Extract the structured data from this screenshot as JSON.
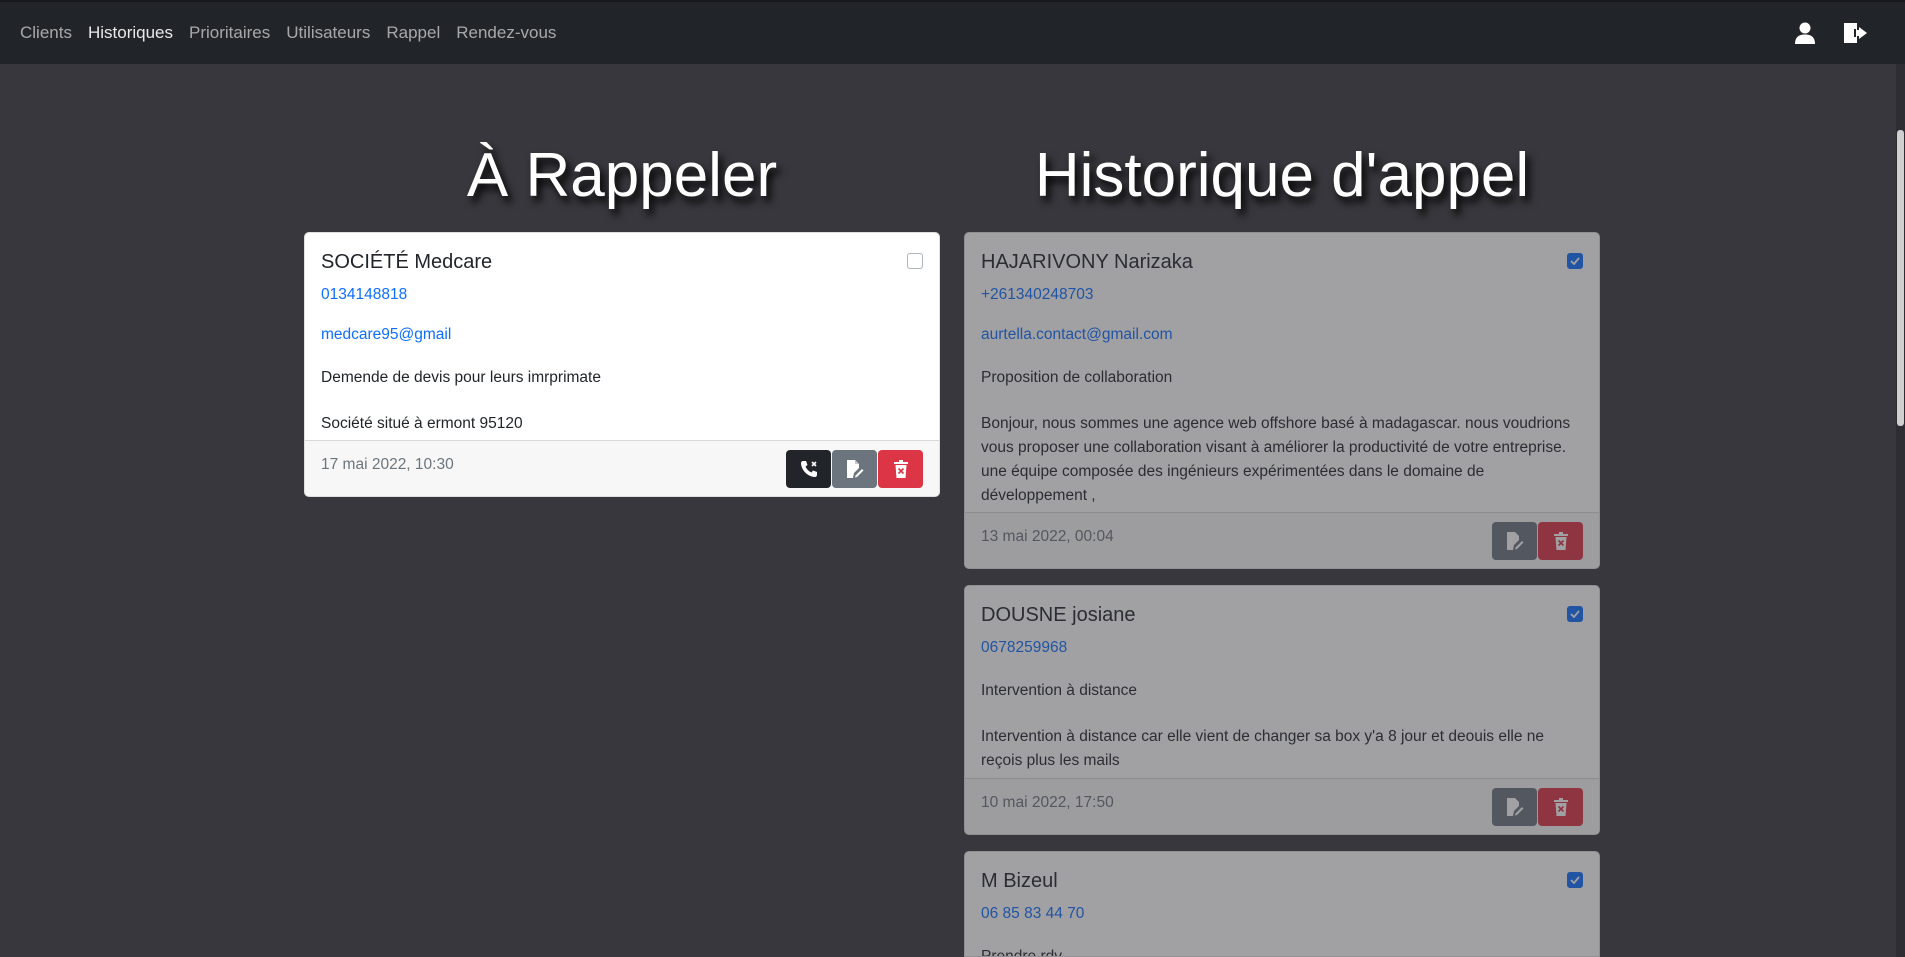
{
  "nav": {
    "links": [
      "Clients",
      "Historiques",
      "Prioritaires",
      "Utilisateurs",
      "Rappel",
      "Rendez-vous"
    ],
    "active": "Historiques",
    "icons": [
      "user-icon",
      "logout-icon"
    ]
  },
  "headings": {
    "left": "À Rappeler",
    "right": "Historique d'appel"
  },
  "rappel": {
    "title": "SOCIÉTÉ Medcare",
    "phone": "0134148818",
    "email": "medcare95@gmail",
    "subject": "Demende de devis pour leurs imrprimate",
    "message": "Société situé à ermont 95120",
    "date": "17 mai 2022, 10:30",
    "checked": false
  },
  "historique": [
    {
      "title": "HAJARIVONY Narizaka",
      "phone": "+261340248703",
      "email": "aurtella.contact@gmail.com",
      "subject": "Proposition de collaboration",
      "message": "Bonjour, nous sommes une agence web offshore basé à madagascar. nous voudrions vous proposer une collaboration visant à améliorer la productivité de votre entreprise. une équipe composée des ingénieurs expérimentées dans le domaine de développement ,",
      "date": "13 mai 2022, 00:04",
      "checked": true
    },
    {
      "title": "DOUSNE josiane",
      "phone": "0678259968",
      "subject": "Intervention à distance",
      "message": "Intervention à distance car elle vient de changer sa box y'a 8 jour et deouis elle ne reçois plus les mails",
      "date": "10 mai 2022, 17:50",
      "checked": true
    },
    {
      "title": "M Bizeul",
      "phone": "06 85 83 44 70",
      "subject": "Prendre rdv",
      "checked": true
    }
  ],
  "colors": {
    "background": "#38373d",
    "navbar": "#212529",
    "primary": "#0d6efd",
    "danger": "#dc3545",
    "secondary": "#6c757d"
  }
}
